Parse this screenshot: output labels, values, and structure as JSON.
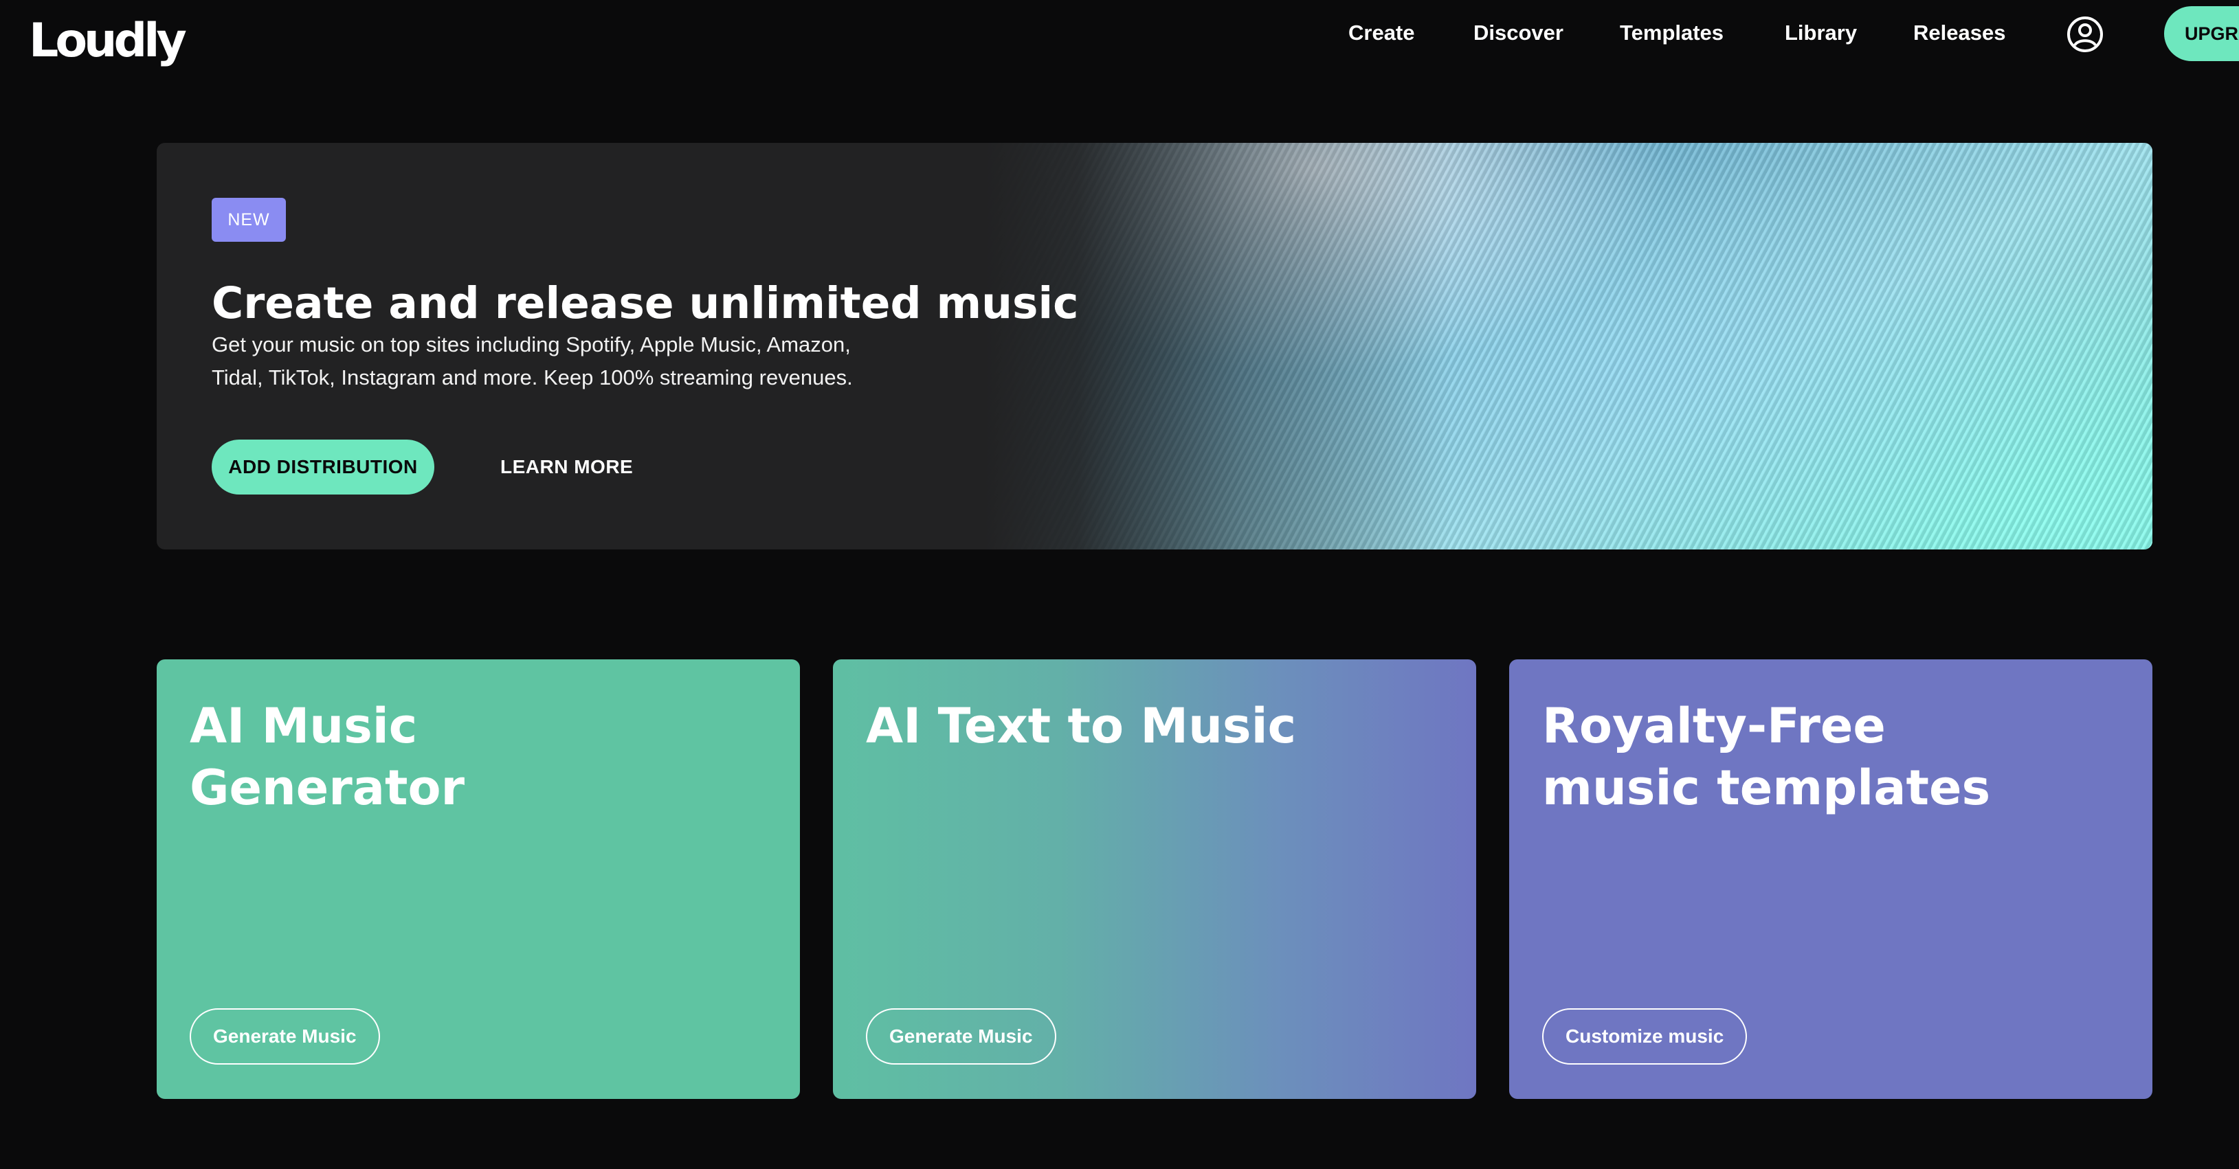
{
  "header": {
    "logo": "Loudly",
    "nav": [
      {
        "label": "Create"
      },
      {
        "label": "Discover"
      },
      {
        "label": "Templates"
      },
      {
        "label": "Library"
      },
      {
        "label": "Releases"
      }
    ],
    "account_icon": "user-circle-icon",
    "upgrade_label": "UPGRADE"
  },
  "hero": {
    "badge": "NEW",
    "title": "Create and release unlimited music",
    "description_line1": "Get your music on top sites including Spotify, Apple Music, Amazon,",
    "description_line2": "Tidal, TikTok, Instagram and more. Keep 100% streaming revenues.",
    "primary_button": "ADD DISTRIBUTION",
    "secondary_button": "LEARN MORE"
  },
  "cards": [
    {
      "title_line1": "AI Music",
      "title_line2": "Generator",
      "button": "Generate Music"
    },
    {
      "title_line1": "AI Text to Music",
      "title_line2": "",
      "button": "Generate Music"
    },
    {
      "title_line1": "Royalty-Free",
      "title_line2": "music templates",
      "button": "Customize music"
    }
  ],
  "colors": {
    "background": "#0a0a0b",
    "accent_mint": "#6ee7be",
    "badge_purple": "#8a8cf2",
    "card_green": "#5fc4a2",
    "card_purple": "#6f76c2",
    "hero_panel": "#222223"
  }
}
